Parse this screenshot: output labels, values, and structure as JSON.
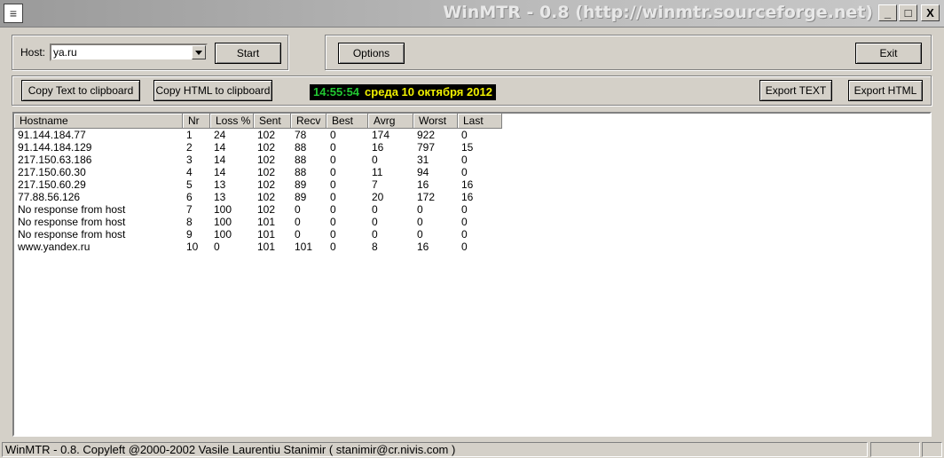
{
  "window": {
    "title": "WinMTR - 0.8 (http://winmtr.sourceforge.net)",
    "controls": {
      "minimize": "_",
      "maximize": "□",
      "close": "X"
    }
  },
  "host_group": {
    "label": "Host:",
    "value": "ya.ru",
    "start_label": "Start"
  },
  "options_group": {
    "options_label": "Options",
    "exit_label": "Exit"
  },
  "toolbar": {
    "copy_text_label": "Copy Text to clipboard",
    "copy_html_label": "Copy HTML to clipboard",
    "clock_time": "14:55:54",
    "clock_date": "среда 10 октября 2012",
    "export_text_label": "Export TEXT",
    "export_html_label": "Export HTML"
  },
  "table": {
    "columns": [
      "Hostname",
      "Nr",
      "Loss %",
      "Sent",
      "Recv",
      "Best",
      "Avrg",
      "Worst",
      "Last"
    ],
    "rows": [
      [
        "91.144.184.77",
        "1",
        "24",
        "102",
        "78",
        "0",
        "174",
        "922",
        "0"
      ],
      [
        "91.144.184.129",
        "2",
        "14",
        "102",
        "88",
        "0",
        "16",
        "797",
        "15"
      ],
      [
        "217.150.63.186",
        "3",
        "14",
        "102",
        "88",
        "0",
        "0",
        "31",
        "0"
      ],
      [
        "217.150.60.30",
        "4",
        "14",
        "102",
        "88",
        "0",
        "11",
        "94",
        "0"
      ],
      [
        "217.150.60.29",
        "5",
        "13",
        "102",
        "89",
        "0",
        "7",
        "16",
        "16"
      ],
      [
        "77.88.56.126",
        "6",
        "13",
        "102",
        "89",
        "0",
        "20",
        "172",
        "16"
      ],
      [
        "No response from host",
        "7",
        "100",
        "102",
        "0",
        "0",
        "0",
        "0",
        "0"
      ],
      [
        "No response from host",
        "8",
        "100",
        "101",
        "0",
        "0",
        "0",
        "0",
        "0"
      ],
      [
        "No response from host",
        "9",
        "100",
        "101",
        "0",
        "0",
        "0",
        "0",
        "0"
      ],
      [
        "www.yandex.ru",
        "10",
        "0",
        "101",
        "101",
        "0",
        "8",
        "16",
        "0"
      ]
    ]
  },
  "statusbar": {
    "text": "WinMTR - 0.8. Copyleft @2000-2002 Vasile Laurentiu Stanimir  ( stanimir@cr.nivis.com )"
  },
  "colors": {
    "face": "#d4d0c8",
    "clock_bg": "#000000",
    "clock_time": "#22c832",
    "clock_date": "#f0f000"
  }
}
